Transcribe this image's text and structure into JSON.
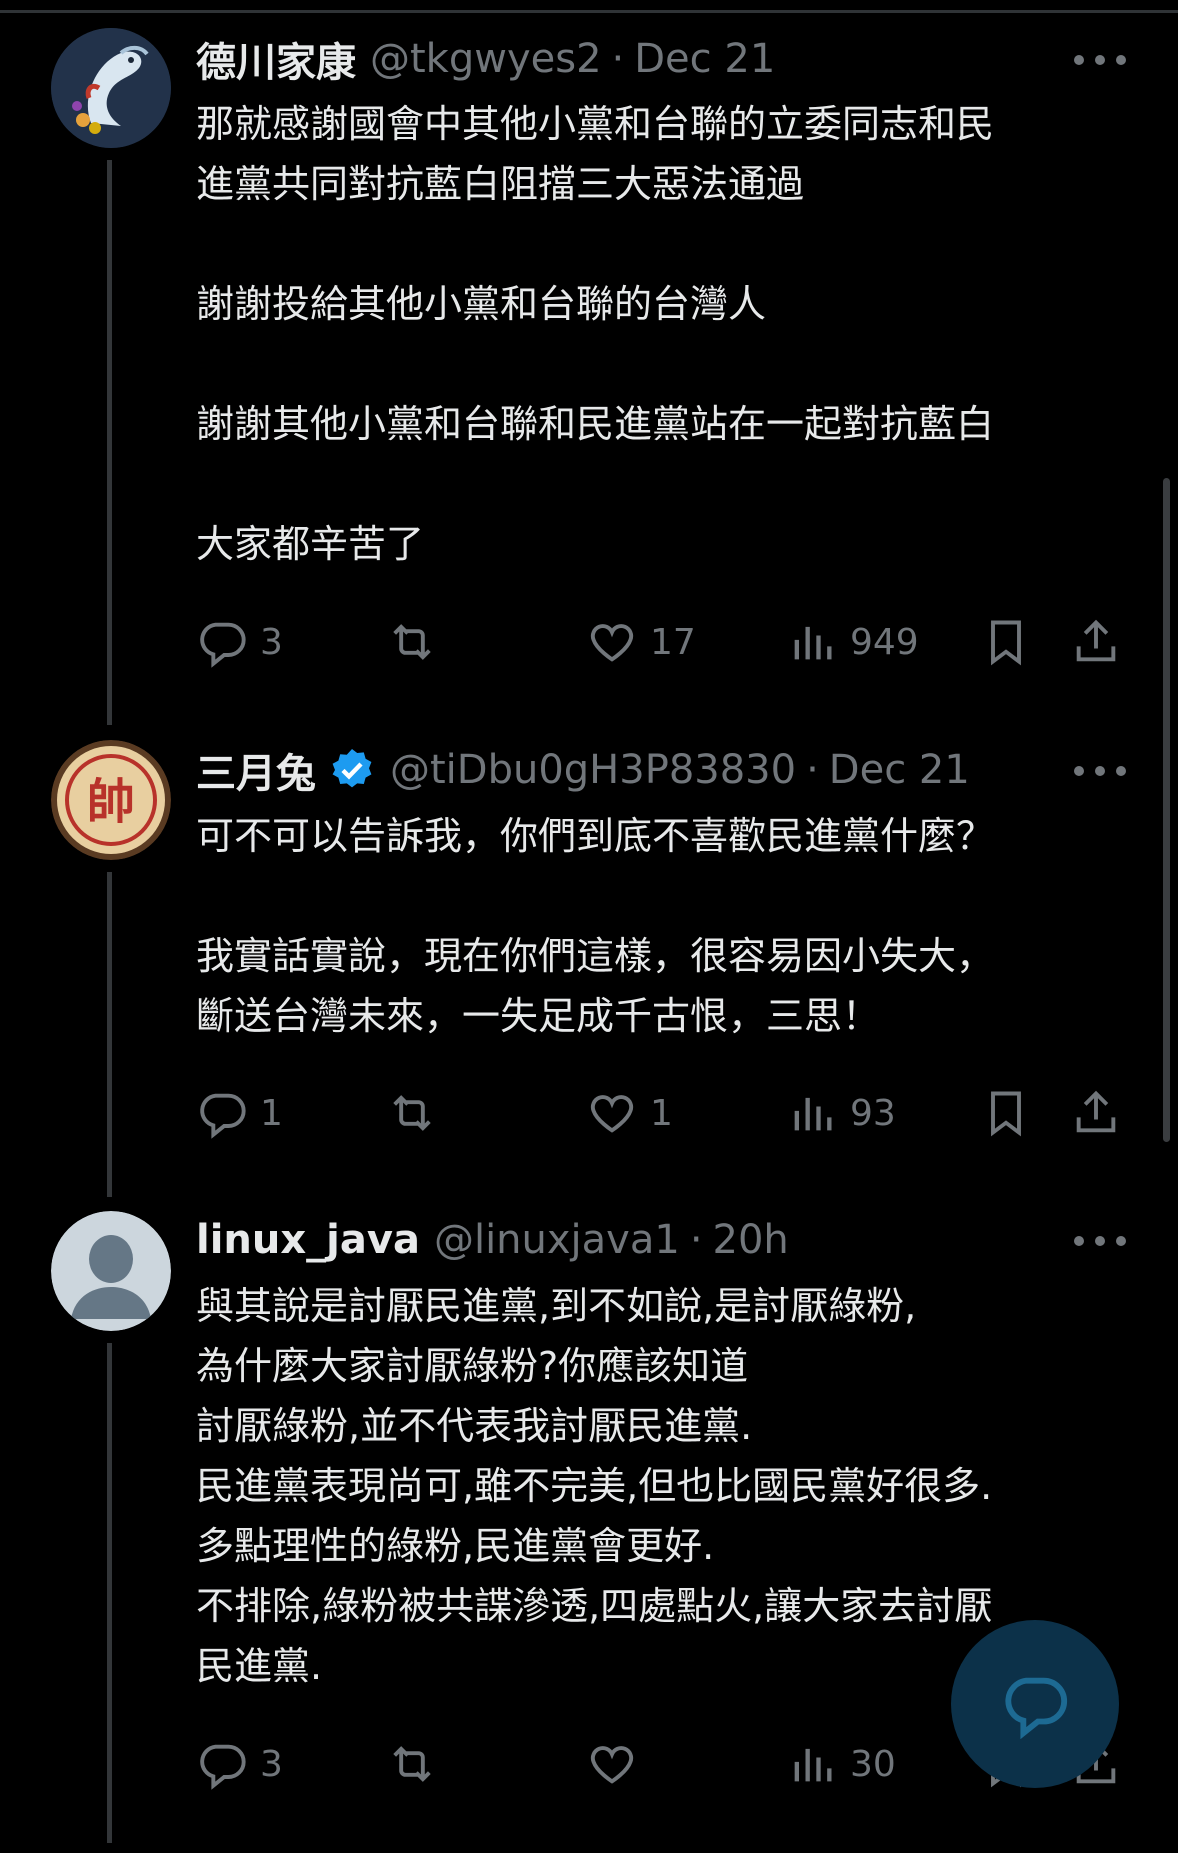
{
  "tweets": [
    {
      "name": "德川家康",
      "handle": "@tkgwyes2",
      "separator": "·",
      "date": "Dec 21",
      "text": "那就感謝國會中其他小黨和台聯的立委同志和民\n進黨共同對抗藍白阻擋三大惡法通過\n\n謝謝投給其他小黨和台聯的台灣人\n\n謝謝其他小黨和台聯和民進黨站在一起對抗藍白\n\n大家都辛苦了",
      "replies": "3",
      "retweets": "",
      "likes": "17",
      "views": "949"
    },
    {
      "name": "三月兔",
      "handle": "@tiDbu0gH3P83830",
      "separator": "·",
      "date": "Dec 21",
      "text": "可不可以告訴我，你們到底不喜歡民進黨什麼？\n\n我實話實說，現在你們這樣，很容易因小失大，\n斷送台灣未來，一失足成千古恨，三思！",
      "replies": "1",
      "retweets": "",
      "likes": "1",
      "views": "93",
      "avatar_char": "帥"
    },
    {
      "name": "linux_java",
      "handle": "@linuxjava1",
      "separator": "·",
      "date": "20h",
      "text": "與其說是討厭民進黨,到不如說,是討厭綠粉,\n為什麼大家討厭綠粉?你應該知道\n討厭綠粉,並不代表我討厭民進黨.\n民進黨表現尚可,雖不完美,但也比國民黨好很多.\n多點理性的綠粉,民進黨會更好.\n不排除,綠粉被共諜滲透,四處點火,讓大家去討厭\n民進黨.",
      "replies": "3",
      "retweets": "",
      "likes": "",
      "views": "30"
    }
  ],
  "icons": {
    "reply": "reply-bubble-icon",
    "retweet": "retweet-icon",
    "like": "heart-icon",
    "views": "views-bar-chart-icon",
    "bookmark": "bookmark-icon",
    "share": "share-upload-icon",
    "more": "more-dots-icon",
    "verified": "verified-badge-icon",
    "compose": "compose-reply-icon"
  },
  "colors": {
    "background": "#000000",
    "text": "#e7e9ea",
    "secondary": "#71767b",
    "verified": "#1d9bf0",
    "fab": "#0c3149"
  }
}
